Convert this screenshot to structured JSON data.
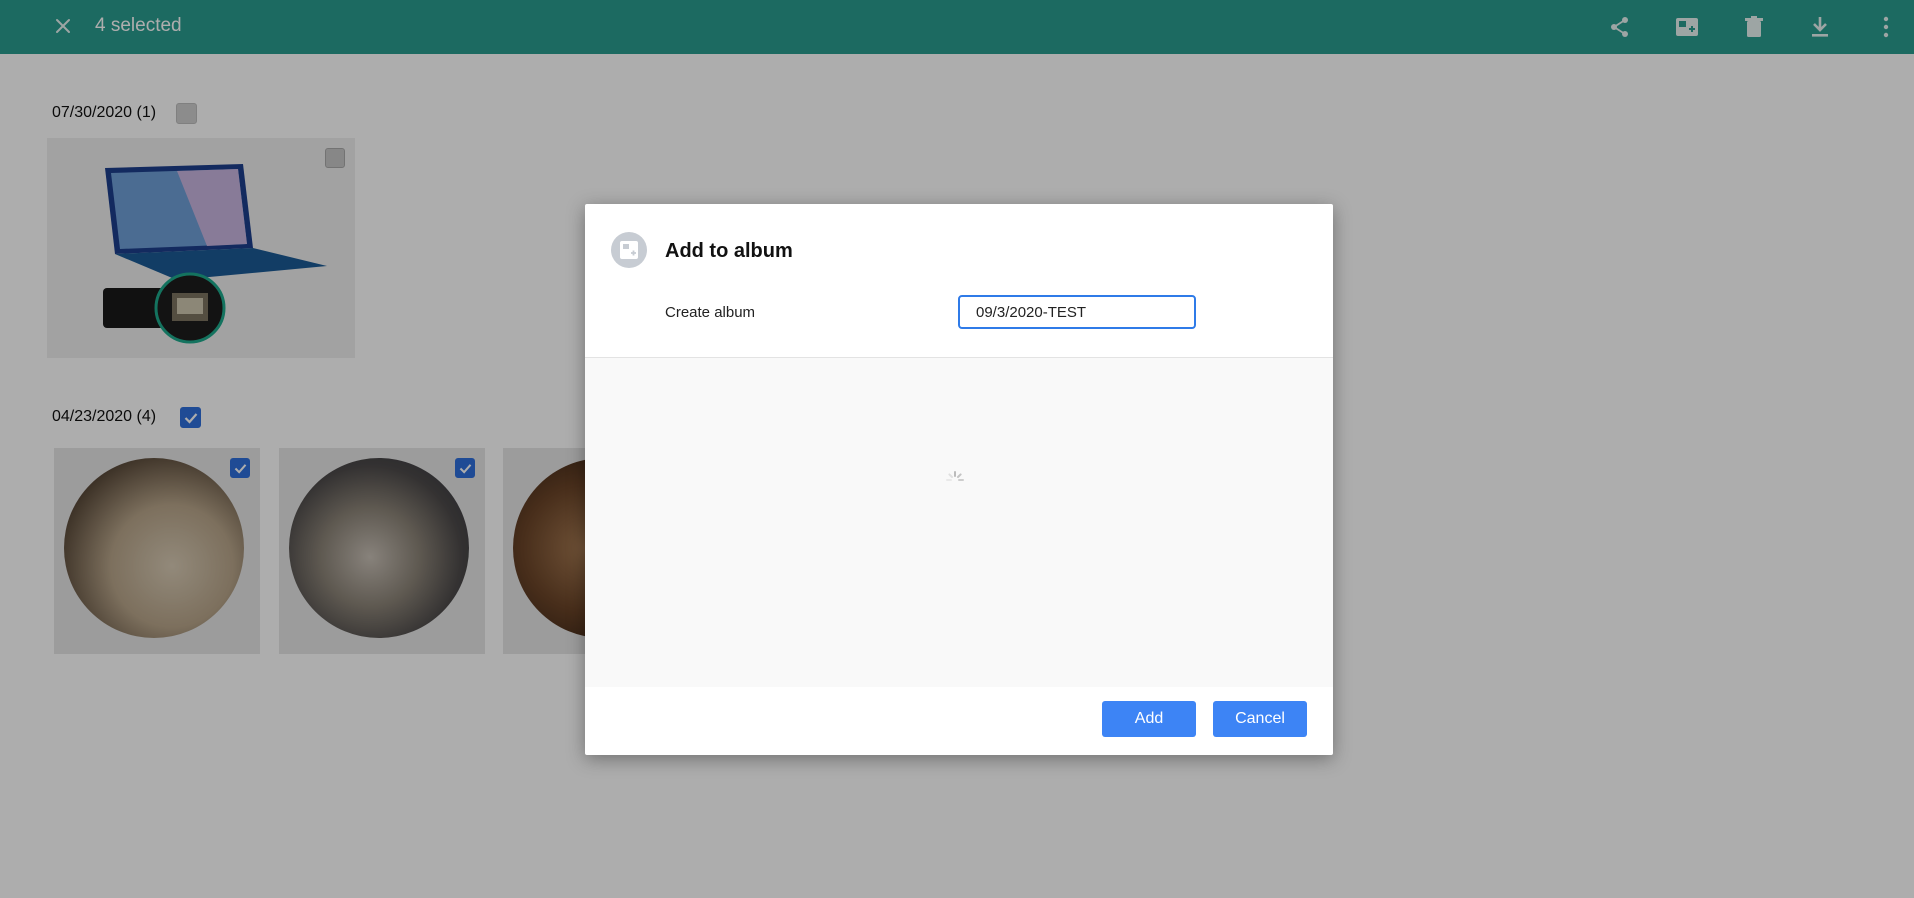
{
  "topbar": {
    "selected_count": "4 selected",
    "close_icon": "close-icon",
    "actions": [
      "share-icon",
      "add-to-album-icon",
      "trash-icon",
      "download-icon",
      "more-vertical-icon"
    ],
    "bg_color": "#2a9d90"
  },
  "groups": [
    {
      "title": "07/30/2020 (1)",
      "checked": false,
      "photos": [
        {
          "selected": false
        }
      ]
    },
    {
      "title": "04/23/2020 (4)",
      "checked": true,
      "photos": [
        {
          "selected": true
        },
        {
          "selected": true
        },
        {
          "selected": true
        }
      ]
    }
  ],
  "dialog": {
    "title": "Add to album",
    "create_label": "Create album",
    "album_name_value": "09/3/2020-TEST",
    "add_label": "Add",
    "cancel_label": "Cancel",
    "accent_color": "#3d84f5"
  }
}
